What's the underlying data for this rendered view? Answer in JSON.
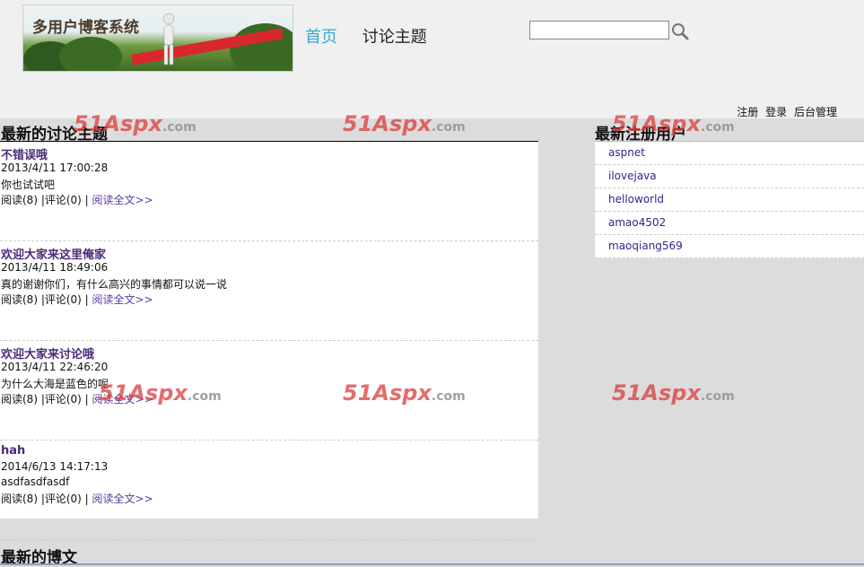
{
  "header": {
    "logo_text": "多用户博客系统",
    "nav": [
      {
        "label": "首页",
        "active": true
      },
      {
        "label": "讨论主题",
        "active": false
      }
    ],
    "search": {
      "value": "",
      "placeholder": ""
    },
    "toplinks": [
      "注册",
      "登录",
      "后台管理"
    ]
  },
  "main": {
    "topics_title": "最新的讨论主题",
    "topics": [
      {
        "title": "不错误哦",
        "date": "2013/4/11 17:00:28",
        "body": "你也试试吧",
        "meta": "阅读(8) |评论(0) | ",
        "read_more": "阅读全文>>"
      },
      {
        "title": "欢迎大家来这里俺家",
        "date": "2013/4/11 18:49:06",
        "body": "真的谢谢你们，有什么高兴的事情都可以说一说",
        "meta": "阅读(8) |评论(0) | ",
        "read_more": "阅读全文>>"
      },
      {
        "title": "欢迎大家来讨论哦",
        "date": "2013/4/11 22:46:20",
        "body": "为什么大海是蓝色的呢",
        "meta": "阅读(8) |评论(0) | ",
        "read_more": "阅读全文>>"
      },
      {
        "title": "hah",
        "date": "2014/6/13 14:17:13",
        "body": "asdfasdfasdf",
        "meta": "阅读(8) |评论(0) | ",
        "read_more": "阅读全文>>"
      }
    ],
    "blogs_title": "最新的博文"
  },
  "sidebar": {
    "users_title": "最新注册用户",
    "users": [
      "aspnet",
      "ilovejava",
      "helloworld",
      "amao4502",
      "maoqiang569"
    ]
  },
  "watermark": {
    "text": "51Aspx",
    "suffix": ".com"
  },
  "colors": {
    "accent": "#3aa8d8",
    "link": "#4a2c7a",
    "user_link": "#3a1d8c",
    "watermark": "#dc3c3c"
  }
}
